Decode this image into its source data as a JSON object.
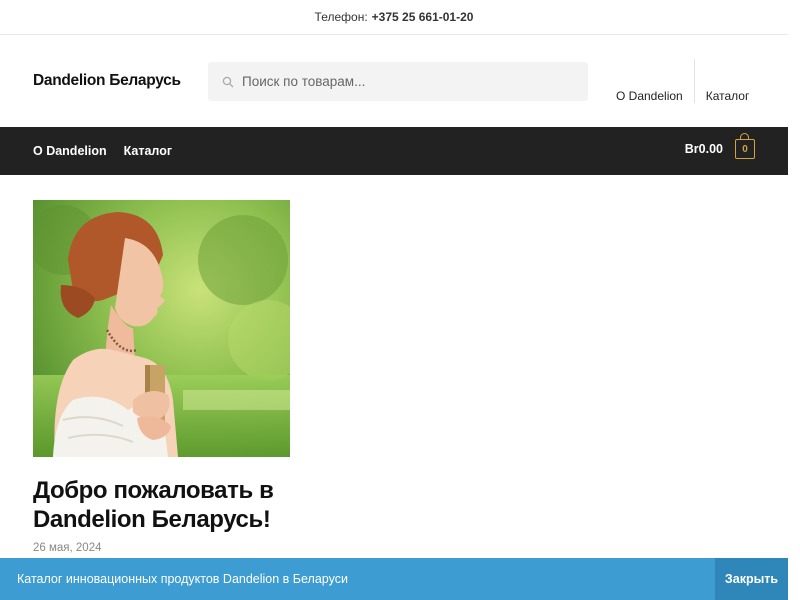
{
  "topbar": {
    "phone_label": "Телефон:",
    "phone_number": "+375 25 661-01-20"
  },
  "header": {
    "site_title": "Dandelion Беларусь",
    "search_placeholder": "Поиск по товарам...",
    "secondary_nav": [
      "O Dandelion",
      "Каталог"
    ]
  },
  "navbar": {
    "items": [
      "O Dandelion",
      "Каталог"
    ],
    "cart_amount": "Br0.00",
    "cart_count": "0",
    "accent_color": "#d4a23f"
  },
  "post": {
    "title": "Добро пожаловать в Dandelion Беларусь!",
    "date": "26 мая, 2024",
    "image": "woman-in-park-illustration"
  },
  "notice": {
    "text": "Каталог инновационных продуктов Dandelion в Беларуси",
    "close_label": "Закрыть",
    "color": "#3d9cd2"
  }
}
